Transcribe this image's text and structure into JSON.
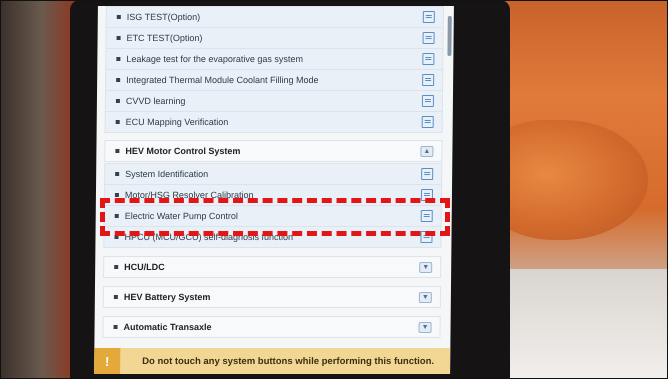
{
  "menu": {
    "items": [
      {
        "label": "ISG TEST(Option)",
        "kind": "sub",
        "icon": "document-icon"
      },
      {
        "label": "ETC TEST(Option)",
        "kind": "sub",
        "icon": "document-icon"
      },
      {
        "label": "Leakage test for the evaporative gas system",
        "kind": "sub",
        "icon": "document-icon"
      },
      {
        "label": "Integrated Thermal Module Coolant Filling Mode",
        "kind": "sub",
        "icon": "document-icon"
      },
      {
        "label": "CVVD learning",
        "kind": "sub",
        "icon": "document-icon"
      },
      {
        "label": "ECU Mapping Verification",
        "kind": "sub",
        "icon": "document-icon"
      },
      {
        "label": "HEV Motor Control System",
        "kind": "head",
        "icon": "collapse-icon"
      },
      {
        "label": "System Identification",
        "kind": "sub",
        "icon": "document-icon"
      },
      {
        "label": "Motor/HSG Resolver Calibration",
        "kind": "sub",
        "icon": "document-icon"
      },
      {
        "label": "Electric Water Pump Control",
        "kind": "sub",
        "icon": "document-icon"
      },
      {
        "label": "HPCU (MCU/GCU) self-diagnosis function",
        "kind": "sub",
        "icon": "document-icon"
      },
      {
        "label": "HCU/LDC",
        "kind": "head",
        "icon": "expand-icon"
      },
      {
        "label": "HEV Battery System",
        "kind": "head",
        "icon": "expand-icon"
      },
      {
        "label": "Automatic Transaxle",
        "kind": "head",
        "icon": "expand-icon"
      }
    ]
  },
  "warning": {
    "icon_text": "!",
    "message": "Do not touch any system buttons while performing this function."
  },
  "highlight_color": "#e41515"
}
